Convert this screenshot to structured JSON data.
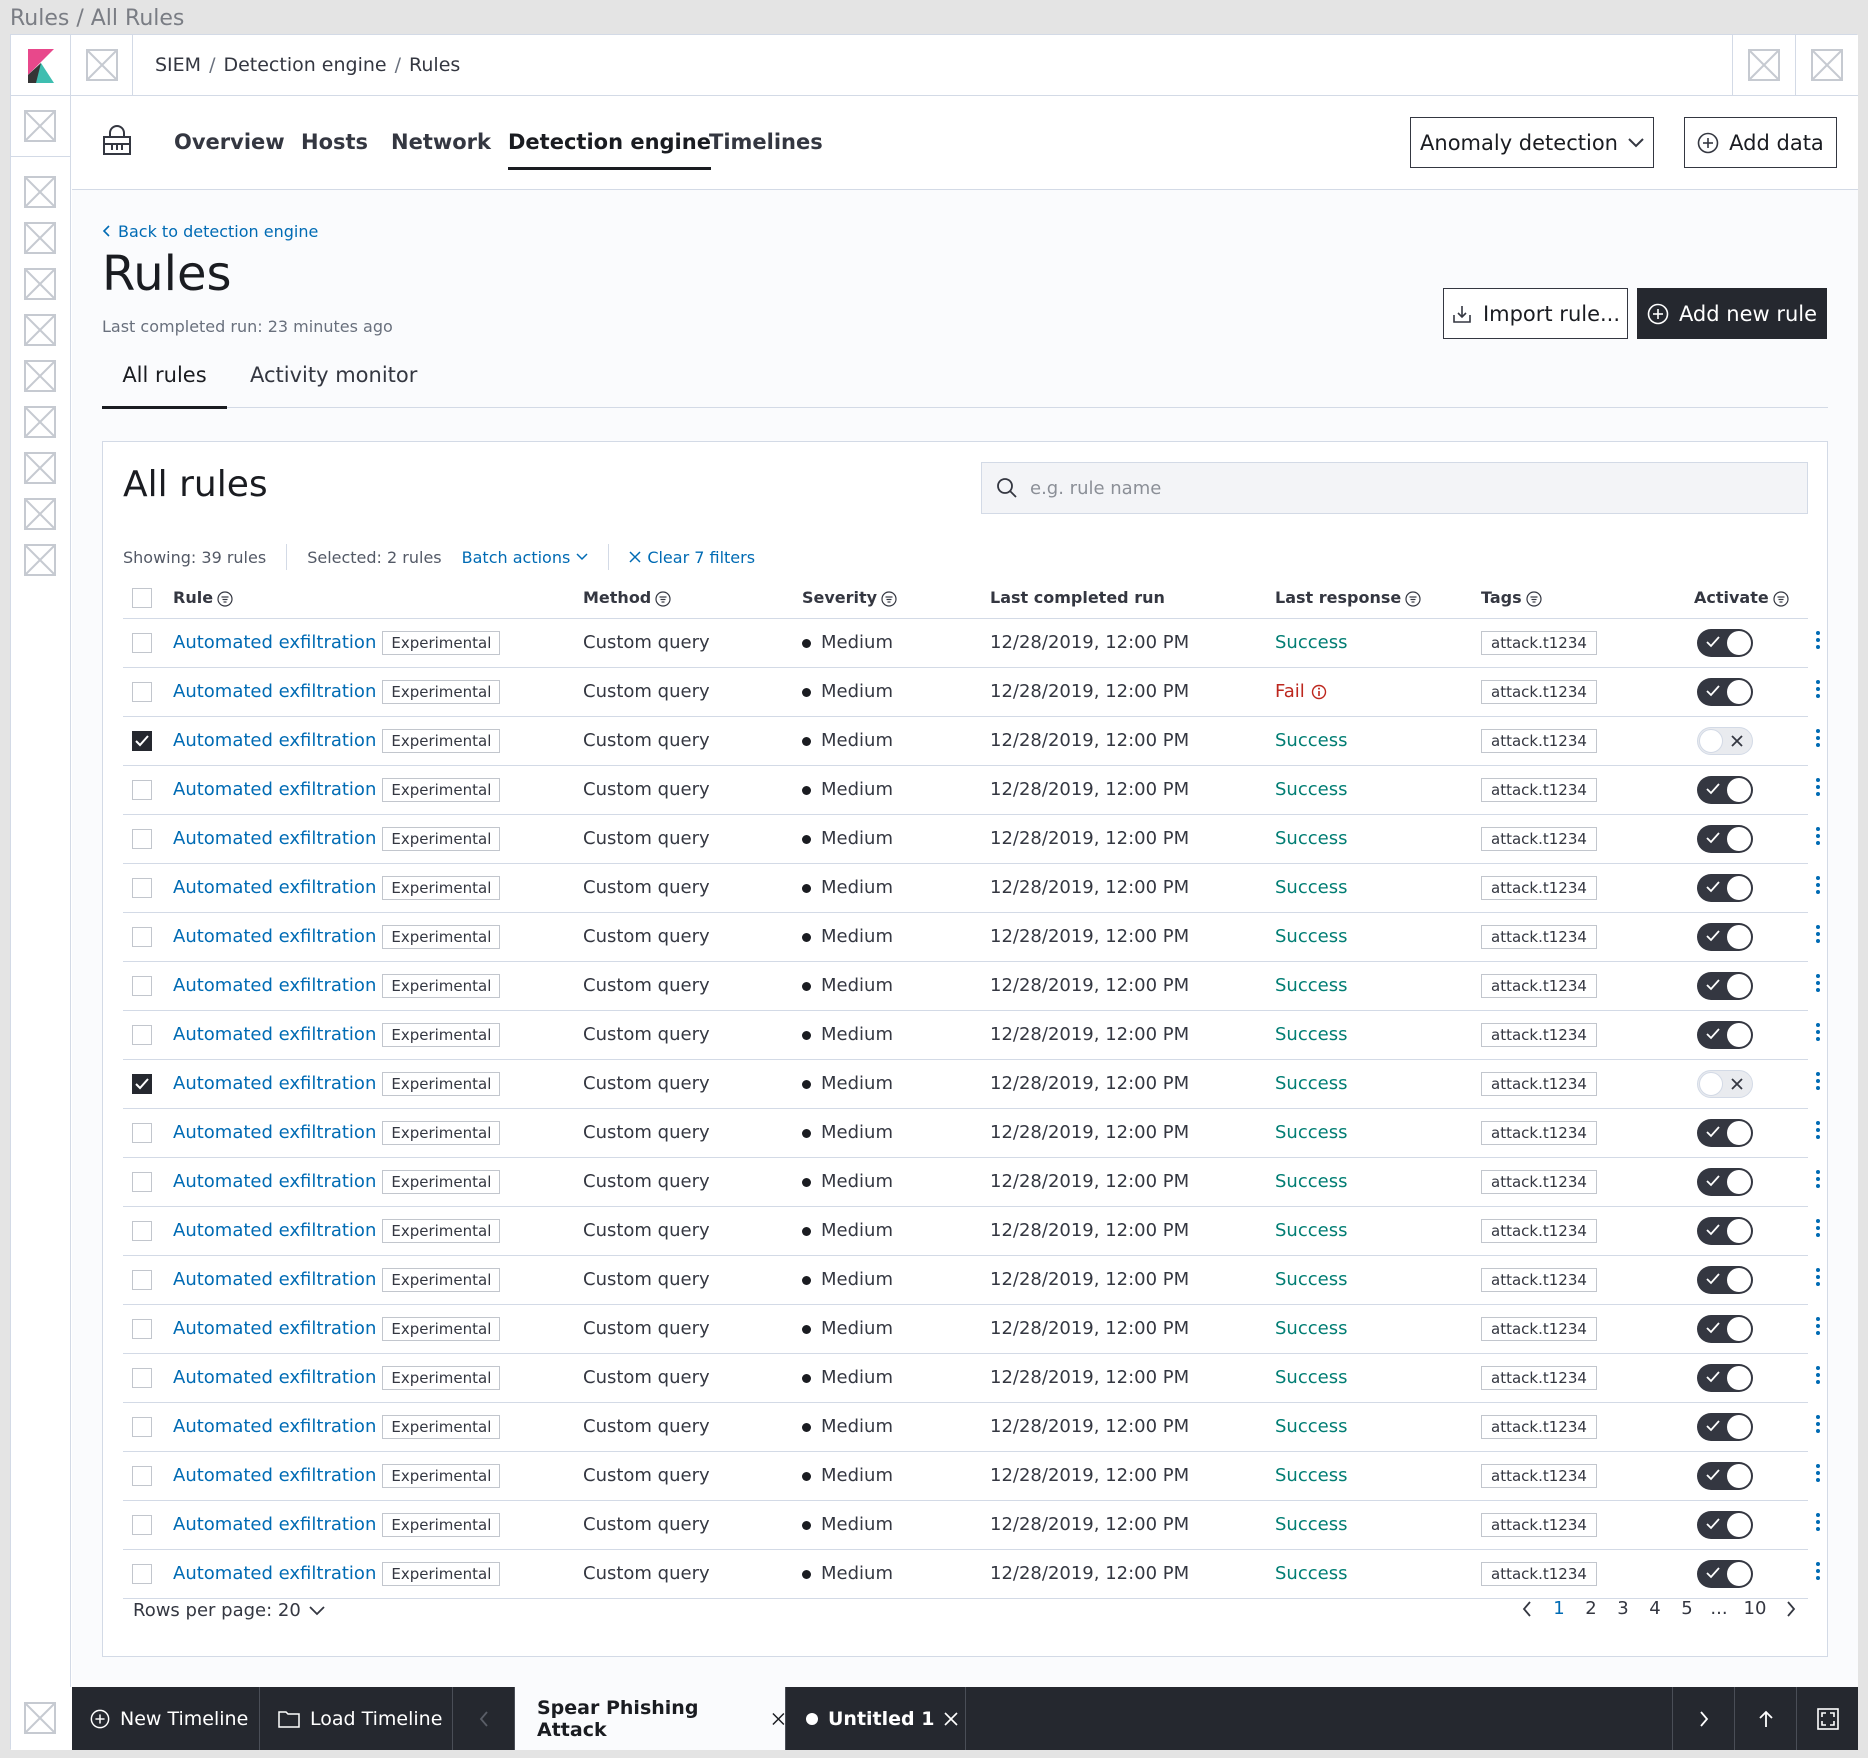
{
  "window_title": "Rules / All Rules",
  "breadcrumbs": [
    "SIEM",
    "Detection engine",
    "Rules"
  ],
  "subnav": {
    "tabs": [
      "Overview",
      "Hosts",
      "Network",
      "Detection engine",
      "Timelines"
    ],
    "active_tab": "Detection engine",
    "anomaly_label": "Anomaly detection",
    "add_data_label": "Add data"
  },
  "page": {
    "back_link": "Back to detection engine",
    "title": "Rules",
    "last_run": "Last completed run: 23 minutes ago",
    "import_label": "Import rule...",
    "add_rule_label": "Add new rule",
    "tabs": [
      "All rules",
      "Activity monitor"
    ],
    "active_tab": "All rules"
  },
  "panel": {
    "title": "All rules",
    "search_placeholder": "e.g. rule name",
    "showing": "Showing: 39 rules",
    "selected": "Selected: 2 rules",
    "batch_actions": "Batch actions",
    "clear_filters": "Clear 7 filters"
  },
  "table": {
    "columns": [
      "Rule",
      "Method",
      "Severity",
      "Last completed run",
      "Last response",
      "Tags",
      "Activate"
    ],
    "rows": [
      {
        "rule": "Automated exfiltration",
        "badge": "Experimental",
        "method": "Custom query",
        "severity": "Medium",
        "last_run": "12/28/2019, 12:00 PM",
        "response": "Success",
        "tag": "attack.t1234",
        "active": true,
        "checked": false
      },
      {
        "rule": "Automated exfiltration",
        "badge": "Experimental",
        "method": "Custom query",
        "severity": "Medium",
        "last_run": "12/28/2019, 12:00 PM",
        "response": "Fail",
        "tag": "attack.t1234",
        "active": true,
        "checked": false
      },
      {
        "rule": "Automated exfiltration",
        "badge": "Experimental",
        "method": "Custom query",
        "severity": "Medium",
        "last_run": "12/28/2019, 12:00 PM",
        "response": "Success",
        "tag": "attack.t1234",
        "active": false,
        "checked": true
      },
      {
        "rule": "Automated exfiltration",
        "badge": "Experimental",
        "method": "Custom query",
        "severity": "Medium",
        "last_run": "12/28/2019, 12:00 PM",
        "response": "Success",
        "tag": "attack.t1234",
        "active": true,
        "checked": false
      },
      {
        "rule": "Automated exfiltration",
        "badge": "Experimental",
        "method": "Custom query",
        "severity": "Medium",
        "last_run": "12/28/2019, 12:00 PM",
        "response": "Success",
        "tag": "attack.t1234",
        "active": true,
        "checked": false
      },
      {
        "rule": "Automated exfiltration",
        "badge": "Experimental",
        "method": "Custom query",
        "severity": "Medium",
        "last_run": "12/28/2019, 12:00 PM",
        "response": "Success",
        "tag": "attack.t1234",
        "active": true,
        "checked": false
      },
      {
        "rule": "Automated exfiltration",
        "badge": "Experimental",
        "method": "Custom query",
        "severity": "Medium",
        "last_run": "12/28/2019, 12:00 PM",
        "response": "Success",
        "tag": "attack.t1234",
        "active": true,
        "checked": false
      },
      {
        "rule": "Automated exfiltration",
        "badge": "Experimental",
        "method": "Custom query",
        "severity": "Medium",
        "last_run": "12/28/2019, 12:00 PM",
        "response": "Success",
        "tag": "attack.t1234",
        "active": true,
        "checked": false
      },
      {
        "rule": "Automated exfiltration",
        "badge": "Experimental",
        "method": "Custom query",
        "severity": "Medium",
        "last_run": "12/28/2019, 12:00 PM",
        "response": "Success",
        "tag": "attack.t1234",
        "active": true,
        "checked": false
      },
      {
        "rule": "Automated exfiltration",
        "badge": "Experimental",
        "method": "Custom query",
        "severity": "Medium",
        "last_run": "12/28/2019, 12:00 PM",
        "response": "Success",
        "tag": "attack.t1234",
        "active": false,
        "checked": true
      },
      {
        "rule": "Automated exfiltration",
        "badge": "Experimental",
        "method": "Custom query",
        "severity": "Medium",
        "last_run": "12/28/2019, 12:00 PM",
        "response": "Success",
        "tag": "attack.t1234",
        "active": true,
        "checked": false
      },
      {
        "rule": "Automated exfiltration",
        "badge": "Experimental",
        "method": "Custom query",
        "severity": "Medium",
        "last_run": "12/28/2019, 12:00 PM",
        "response": "Success",
        "tag": "attack.t1234",
        "active": true,
        "checked": false
      },
      {
        "rule": "Automated exfiltration",
        "badge": "Experimental",
        "method": "Custom query",
        "severity": "Medium",
        "last_run": "12/28/2019, 12:00 PM",
        "response": "Success",
        "tag": "attack.t1234",
        "active": true,
        "checked": false
      },
      {
        "rule": "Automated exfiltration",
        "badge": "Experimental",
        "method": "Custom query",
        "severity": "Medium",
        "last_run": "12/28/2019, 12:00 PM",
        "response": "Success",
        "tag": "attack.t1234",
        "active": true,
        "checked": false
      },
      {
        "rule": "Automated exfiltration",
        "badge": "Experimental",
        "method": "Custom query",
        "severity": "Medium",
        "last_run": "12/28/2019, 12:00 PM",
        "response": "Success",
        "tag": "attack.t1234",
        "active": true,
        "checked": false
      },
      {
        "rule": "Automated exfiltration",
        "badge": "Experimental",
        "method": "Custom query",
        "severity": "Medium",
        "last_run": "12/28/2019, 12:00 PM",
        "response": "Success",
        "tag": "attack.t1234",
        "active": true,
        "checked": false
      },
      {
        "rule": "Automated exfiltration",
        "badge": "Experimental",
        "method": "Custom query",
        "severity": "Medium",
        "last_run": "12/28/2019, 12:00 PM",
        "response": "Success",
        "tag": "attack.t1234",
        "active": true,
        "checked": false
      },
      {
        "rule": "Automated exfiltration",
        "badge": "Experimental",
        "method": "Custom query",
        "severity": "Medium",
        "last_run": "12/28/2019, 12:00 PM",
        "response": "Success",
        "tag": "attack.t1234",
        "active": true,
        "checked": false
      },
      {
        "rule": "Automated exfiltration",
        "badge": "Experimental",
        "method": "Custom query",
        "severity": "Medium",
        "last_run": "12/28/2019, 12:00 PM",
        "response": "Success",
        "tag": "attack.t1234",
        "active": true,
        "checked": false
      },
      {
        "rule": "Automated exfiltration",
        "badge": "Experimental",
        "method": "Custom query",
        "severity": "Medium",
        "last_run": "12/28/2019, 12:00 PM",
        "response": "Success",
        "tag": "attack.t1234",
        "active": true,
        "checked": false
      }
    ]
  },
  "pagination": {
    "rows_per_page": "Rows per page: 20",
    "pages": [
      "1",
      "2",
      "3",
      "4",
      "5",
      "...",
      "10"
    ],
    "active_page": "1"
  },
  "timeline_bar": {
    "new_timeline": "New Timeline",
    "load_timeline": "Load Timeline",
    "tabs": [
      "Spear Phishing Attack",
      "Untitled 1"
    ]
  },
  "icons": {
    "logo": "kibana-logo-icon",
    "lock": "lock-icon",
    "search": "search-icon",
    "sort": "sort-filter-icon",
    "kebab": "more-vertical-icon",
    "placeholder": "placeholder-icon"
  },
  "colors": {
    "link": "#006bb4",
    "success": "#017d73",
    "fail": "#bd271e",
    "dark": "#25282f"
  }
}
